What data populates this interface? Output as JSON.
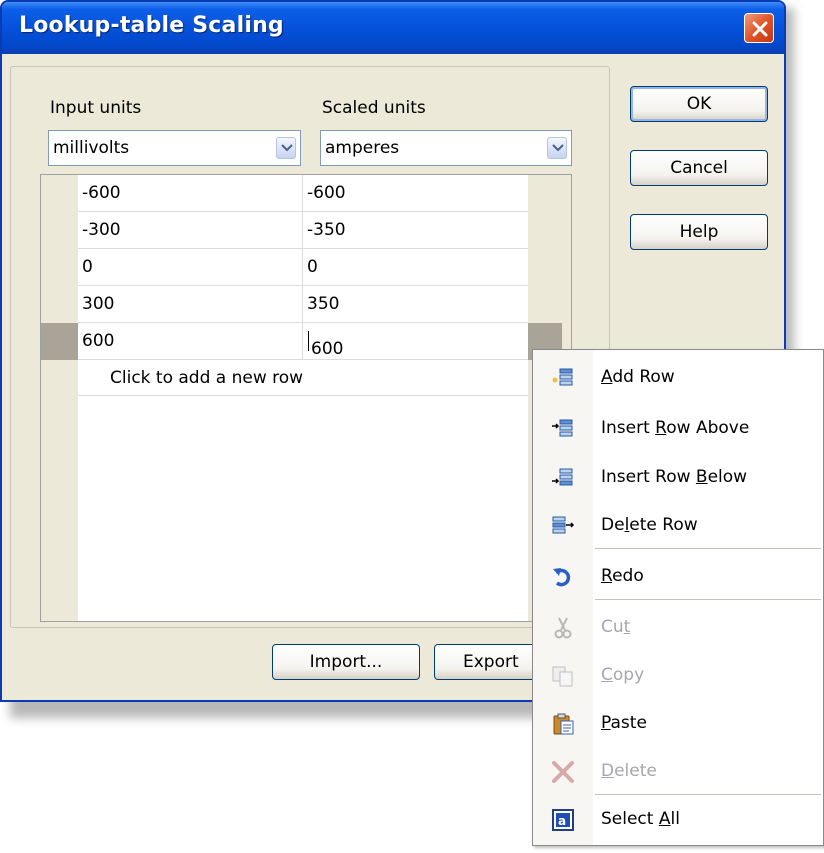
{
  "dialog": {
    "title": "Lookup-table Scaling",
    "input_units_label": "Input units",
    "scaled_units_label": "Scaled units",
    "input_units_value": "millivolts",
    "scaled_units_value": "amperes"
  },
  "table": {
    "rows": [
      [
        "-600",
        "-600"
      ],
      [
        "-300",
        "-350"
      ],
      [
        "0",
        "0"
      ],
      [
        "300",
        "350"
      ],
      [
        "600",
        "600"
      ]
    ],
    "new_row_text": "Click to add a new row"
  },
  "buttons": {
    "ok": "OK",
    "cancel": "Cancel",
    "help": "Help",
    "import": "Import...",
    "export": "Export"
  },
  "context_menu": {
    "items": [
      {
        "label": "Add Row",
        "mnemonic_index": 0,
        "icon": "add-row-icon",
        "enabled": true
      },
      {
        "label": "Insert Row Above",
        "mnemonic_index": 7,
        "icon": "insert-row-above-icon",
        "enabled": true
      },
      {
        "label": "Insert Row Below",
        "mnemonic_index": 11,
        "icon": "insert-row-below-icon",
        "enabled": true
      },
      {
        "label": "Delete Row",
        "mnemonic_index": 2,
        "icon": "delete-row-icon",
        "enabled": true
      },
      {
        "label": "Redo",
        "mnemonic_index": 0,
        "icon": "redo-icon",
        "enabled": true
      },
      {
        "label": "Cut",
        "mnemonic_index": 2,
        "icon": "scissors-icon",
        "enabled": false
      },
      {
        "label": "Copy",
        "mnemonic_index": 0,
        "icon": "copy-icon",
        "enabled": false
      },
      {
        "label": "Paste",
        "mnemonic_index": 0,
        "icon": "paste-icon",
        "enabled": true
      },
      {
        "label": "Delete",
        "mnemonic_index": 0,
        "icon": "delete-icon",
        "enabled": false
      },
      {
        "label": "Select All",
        "mnemonic_index": 7,
        "icon": "select-all-icon",
        "enabled": true
      }
    ]
  },
  "colors": {
    "title_bar": "#0551dc",
    "dialog_face": "#ece9d8",
    "close_button": "#e0562a",
    "selected_row_header": "#a9a497",
    "disabled_text": "#a7a6aa"
  }
}
